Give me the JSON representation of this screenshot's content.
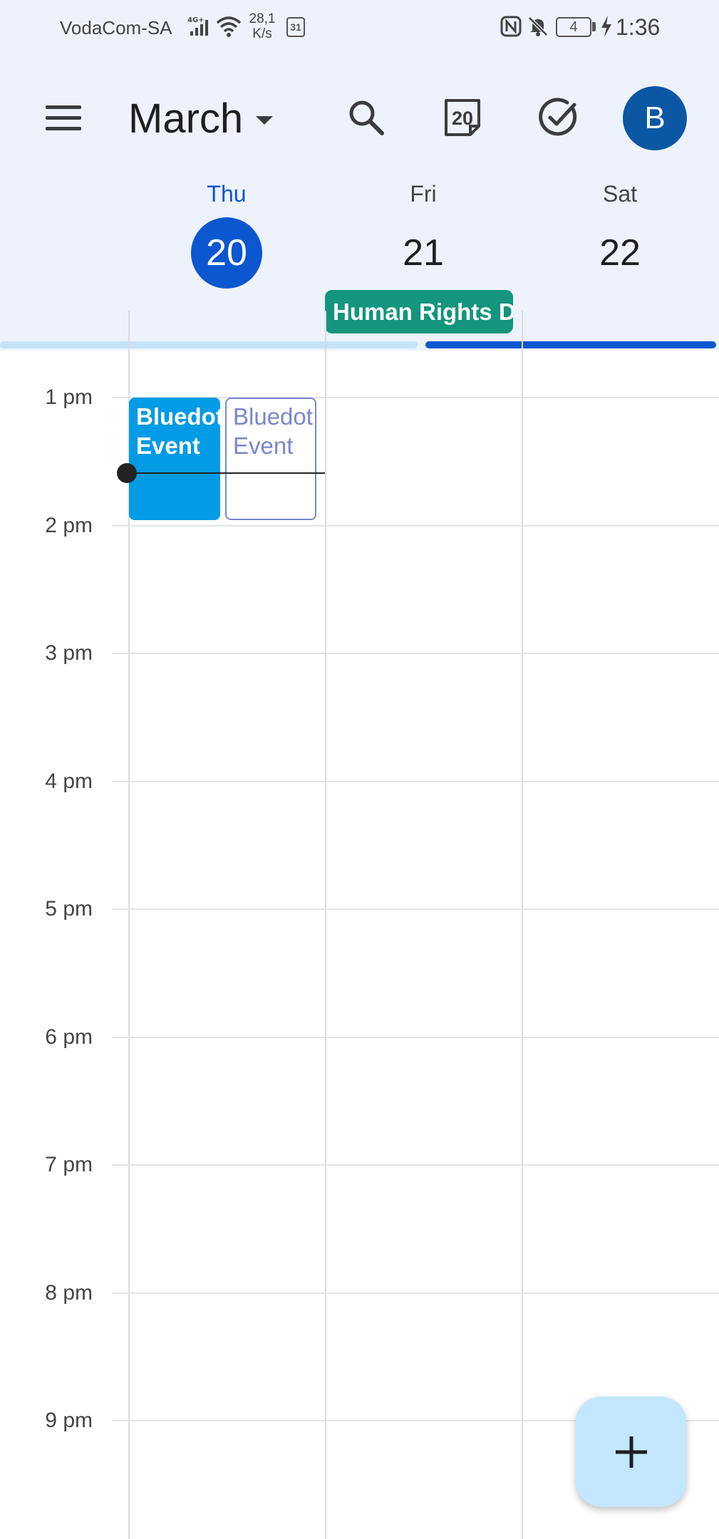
{
  "status_bar": {
    "carrier": "VodaCom-SA",
    "network_type": "4G+",
    "net_speed_value": "28,1",
    "net_speed_unit": "K/s",
    "calendar_notification": "31",
    "battery_level": "4",
    "time": "1:36"
  },
  "app_bar": {
    "month": "March",
    "today_icon_number": "20",
    "avatar_initial": "B"
  },
  "days": [
    {
      "name": "Thu",
      "number": "20",
      "is_today": true
    },
    {
      "name": "Fri",
      "number": "21",
      "is_today": false
    },
    {
      "name": "Sat",
      "number": "22",
      "is_today": false
    }
  ],
  "all_day_event": {
    "title": "Human Rights D",
    "color": "#13957e"
  },
  "time_labels": [
    "1 pm",
    "2 pm",
    "3 pm",
    "4 pm",
    "5 pm",
    "6 pm",
    "7 pm",
    "8 pm",
    "9 pm"
  ],
  "events": [
    {
      "title": "Bluedot Event",
      "style": "filled",
      "color": "#039be5"
    },
    {
      "title": "Bluedot Event",
      "style": "outlined",
      "color": "#7986cb"
    }
  ],
  "colors": {
    "header_bg": "#eef2fc",
    "accent": "#0b57d0",
    "avatar": "#0b57a4",
    "fab": "#c2e7ff"
  }
}
